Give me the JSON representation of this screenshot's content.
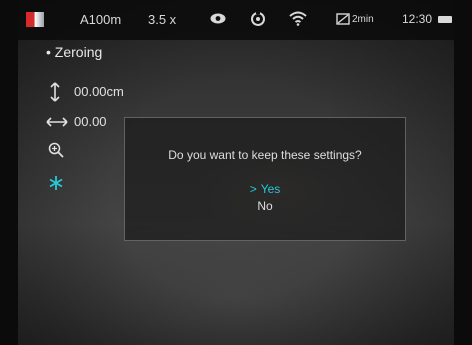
{
  "statusbar": {
    "palette_icon": "palette-red-icon",
    "range": "A100m",
    "zoom": "3.5 x",
    "eye_icon": "eye-icon",
    "target_icon": "rotate-icon",
    "wifi_icon": "wifi-icon",
    "record_icon": "photo-timer-icon",
    "timer": "2min",
    "time": "12:30",
    "battery_icon": "battery-icon"
  },
  "menu": {
    "title": "Zeroing",
    "rows": [
      {
        "icon": "vertical-arrows-icon",
        "value": "00.00cm"
      },
      {
        "icon": "horizontal-arrows-icon",
        "value": "00.00"
      },
      {
        "icon": "zoom-in-icon",
        "value": ""
      },
      {
        "icon": "snowflake-icon",
        "value": ""
      }
    ]
  },
  "dialog": {
    "question": "Do you want to keep these settings?",
    "options": [
      {
        "label": "Yes",
        "selected": true
      },
      {
        "label": "No",
        "selected": false
      }
    ],
    "selected_color": "#28c8d8"
  }
}
